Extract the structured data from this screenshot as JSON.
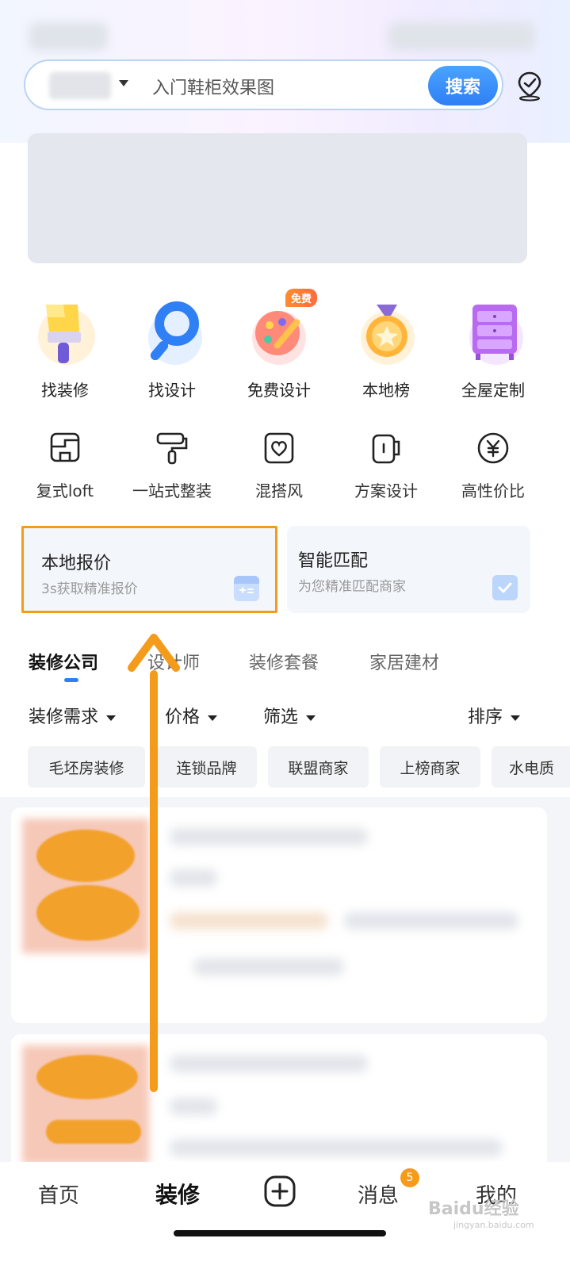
{
  "search": {
    "placeholder": "入门鞋柜效果图",
    "button_label": "搜索"
  },
  "categories": [
    {
      "label": "找装修",
      "icon": "paint-brush-icon"
    },
    {
      "label": "找设计",
      "icon": "magnifier-icon"
    },
    {
      "label": "免费设计",
      "icon": "palette-icon",
      "badge": "免费"
    },
    {
      "label": "本地榜",
      "icon": "medal-icon"
    },
    {
      "label": "全屋定制",
      "icon": "cabinet-icon"
    }
  ],
  "sub_categories": [
    {
      "label": "复式loft",
      "icon": "loft-icon"
    },
    {
      "label": "一站式整装",
      "icon": "paint-roller-icon"
    },
    {
      "label": "混搭风",
      "icon": "heart-frame-icon"
    },
    {
      "label": "方案设计",
      "icon": "cup-icon"
    },
    {
      "label": "高性价比",
      "icon": "yen-icon"
    }
  ],
  "cards": [
    {
      "title": "本地报价",
      "subtitle": "3s获取精准报价",
      "icon": "calculator-icon"
    },
    {
      "title": "智能匹配",
      "subtitle": "为您精准匹配商家",
      "icon": "checklist-icon"
    }
  ],
  "tabs": [
    "装修公司",
    "设计师",
    "装修套餐",
    "家居建材"
  ],
  "filters": [
    "装修需求",
    "价格",
    "筛选",
    "排序"
  ],
  "chips": [
    "毛坯房装修",
    "连锁品牌",
    "联盟商家",
    "上榜商家",
    "水电质"
  ],
  "bottom_nav": {
    "home": "首页",
    "decor": "装修",
    "messages": "消息",
    "messages_badge": "5",
    "mine": "我的"
  },
  "watermark": {
    "brand": "Baidu经验",
    "url": "jingyan.baidu.com"
  },
  "colors": {
    "accent_blue": "#2f7ff5",
    "highlight_orange": "#f59b1c"
  }
}
